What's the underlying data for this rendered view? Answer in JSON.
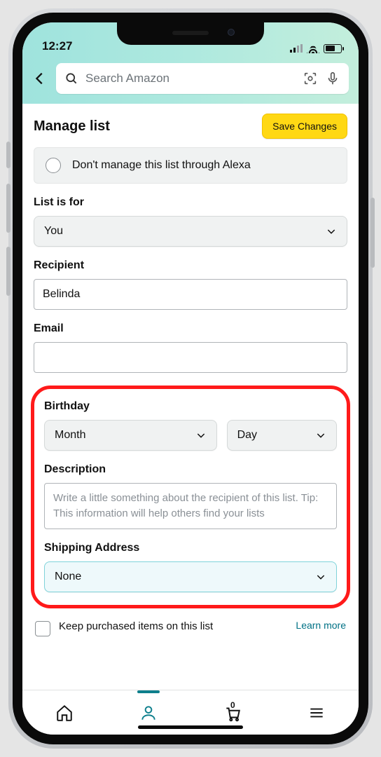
{
  "status": {
    "time": "12:27"
  },
  "search": {
    "placeholder": "Search Amazon"
  },
  "page": {
    "title": "Manage list",
    "save_label": "Save Changes"
  },
  "alexa": {
    "label": "Don't manage this list through Alexa"
  },
  "list_for": {
    "label": "List is for",
    "value": "You"
  },
  "recipient": {
    "label": "Recipient",
    "value": "Belinda"
  },
  "email": {
    "label": "Email",
    "value": ""
  },
  "birthday": {
    "label": "Birthday",
    "month": "Month",
    "day": "Day"
  },
  "description": {
    "label": "Description",
    "placeholder": "Write a little something about the recipient of this list. Tip: This information will help others find your lists"
  },
  "shipping": {
    "label": "Shipping Address",
    "value": "None"
  },
  "keep": {
    "label": "Keep purchased items on this list",
    "learn": "Learn more"
  },
  "cart": {
    "count": "0"
  }
}
